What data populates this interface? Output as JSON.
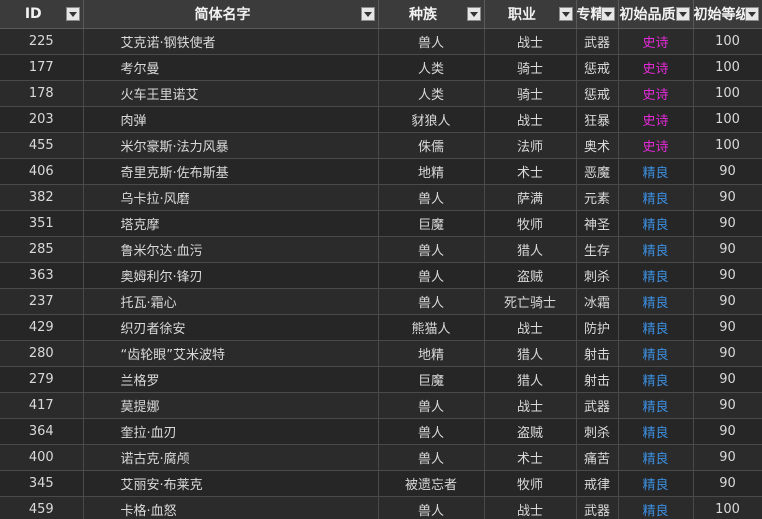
{
  "colors": {
    "epic": "#e52ad8",
    "fine": "#3b8fe0"
  },
  "headers": {
    "id": "ID",
    "name": "简体名字",
    "race": "种族",
    "class": "职业",
    "spec": "专精",
    "quality": "初始品质",
    "level": "初始等级"
  },
  "filter_icon": "dropdown-arrow-icon",
  "rows": [
    {
      "id": "225",
      "name": "艾克诺·钢铁使者",
      "race": "兽人",
      "class": "战士",
      "spec": "武器",
      "quality": "史诗",
      "quality_type": "epic",
      "level": "100"
    },
    {
      "id": "177",
      "name": "考尔曼",
      "race": "人类",
      "class": "骑士",
      "spec": "惩戒",
      "quality": "史诗",
      "quality_type": "epic",
      "level": "100"
    },
    {
      "id": "178",
      "name": "火车王里诺艾",
      "race": "人类",
      "class": "骑士",
      "spec": "惩戒",
      "quality": "史诗",
      "quality_type": "epic",
      "level": "100"
    },
    {
      "id": "203",
      "name": "肉弹",
      "race": "豺狼人",
      "class": "战士",
      "spec": "狂暴",
      "quality": "史诗",
      "quality_type": "epic",
      "level": "100"
    },
    {
      "id": "455",
      "name": "米尔豪斯·法力风暴",
      "race": "侏儒",
      "class": "法师",
      "spec": "奥术",
      "quality": "史诗",
      "quality_type": "epic",
      "level": "100"
    },
    {
      "id": "406",
      "name": "奇里克斯·佐布斯基",
      "race": "地精",
      "class": "术士",
      "spec": "恶魔",
      "quality": "精良",
      "quality_type": "fine",
      "level": "90"
    },
    {
      "id": "382",
      "name": "乌卡拉·风磨",
      "race": "兽人",
      "class": "萨满",
      "spec": "元素",
      "quality": "精良",
      "quality_type": "fine",
      "level": "90"
    },
    {
      "id": "351",
      "name": "塔克摩",
      "race": "巨魔",
      "class": "牧师",
      "spec": "神圣",
      "quality": "精良",
      "quality_type": "fine",
      "level": "90"
    },
    {
      "id": "285",
      "name": "鲁米尔达·血污",
      "race": "兽人",
      "class": "猎人",
      "spec": "生存",
      "quality": "精良",
      "quality_type": "fine",
      "level": "90"
    },
    {
      "id": "363",
      "name": "奥姆利尔·锋刃",
      "race": "兽人",
      "class": "盗贼",
      "spec": "刺杀",
      "quality": "精良",
      "quality_type": "fine",
      "level": "90"
    },
    {
      "id": "237",
      "name": "托瓦·霜心",
      "race": "兽人",
      "class": "死亡骑士",
      "spec": "冰霜",
      "quality": "精良",
      "quality_type": "fine",
      "level": "90"
    },
    {
      "id": "429",
      "name": "织刃者徐安",
      "race": "熊猫人",
      "class": "战士",
      "spec": "防护",
      "quality": "精良",
      "quality_type": "fine",
      "level": "90"
    },
    {
      "id": "280",
      "name": "“齿轮眼”艾米波特",
      "race": "地精",
      "class": "猎人",
      "spec": "射击",
      "quality": "精良",
      "quality_type": "fine",
      "level": "90"
    },
    {
      "id": "279",
      "name": "兰格罗",
      "race": "巨魔",
      "class": "猎人",
      "spec": "射击",
      "quality": "精良",
      "quality_type": "fine",
      "level": "90"
    },
    {
      "id": "417",
      "name": "莫提娜",
      "race": "兽人",
      "class": "战士",
      "spec": "武器",
      "quality": "精良",
      "quality_type": "fine",
      "level": "90"
    },
    {
      "id": "364",
      "name": "奎拉·血刃",
      "race": "兽人",
      "class": "盗贼",
      "spec": "刺杀",
      "quality": "精良",
      "quality_type": "fine",
      "level": "90"
    },
    {
      "id": "400",
      "name": "诺古克·腐颅",
      "race": "兽人",
      "class": "术士",
      "spec": "痛苦",
      "quality": "精良",
      "quality_type": "fine",
      "level": "90"
    },
    {
      "id": "345",
      "name": "艾丽安·布莱克",
      "race": "被遗忘者",
      "class": "牧师",
      "spec": "戒律",
      "quality": "精良",
      "quality_type": "fine",
      "level": "90"
    },
    {
      "id": "459",
      "name": "卡格·血怒",
      "race": "兽人",
      "class": "战士",
      "spec": "武器",
      "quality": "精良",
      "quality_type": "fine",
      "level": "100"
    }
  ]
}
